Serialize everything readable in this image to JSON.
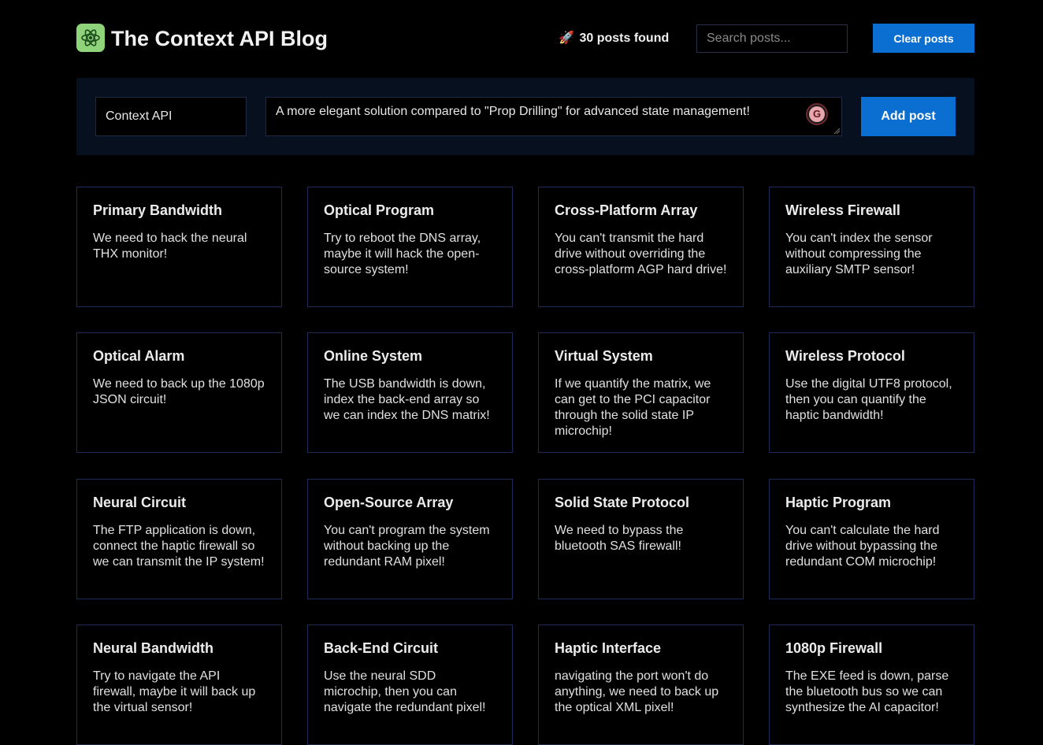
{
  "header": {
    "title": "The Context API Blog",
    "logo_icon": "atom-icon",
    "posts_found_emoji": "🚀",
    "posts_found": "30 posts found",
    "search_placeholder": "Search posts...",
    "clear_label": "Clear posts"
  },
  "form": {
    "title_value": "Context API",
    "body_value": "A more elegant solution compared to \"Prop Drilling\" for advanced state management!",
    "add_label": "Add post",
    "grammar_icon_letter": "G"
  },
  "posts": [
    {
      "title": "Primary Bandwidth",
      "body": "We need to hack the neural THX monitor!"
    },
    {
      "title": "Optical Program",
      "body": "Try to reboot the DNS array, maybe it will hack the open-source system!"
    },
    {
      "title": "Cross-Platform Array",
      "body": "You can't transmit the hard drive without overriding the cross-platform AGP hard drive!"
    },
    {
      "title": "Wireless Firewall",
      "body": "You can't index the sensor without compressing the auxiliary SMTP sensor!"
    },
    {
      "title": "Optical Alarm",
      "body": "We need to back up the 1080p JSON circuit!"
    },
    {
      "title": "Online System",
      "body": "The USB bandwidth is down, index the back-end array so we can index the DNS matrix!"
    },
    {
      "title": "Virtual System",
      "body": "If we quantify the matrix, we can get to the PCI capacitor through the solid state IP microchip!"
    },
    {
      "title": "Wireless Protocol",
      "body": "Use the digital UTF8 protocol, then you can quantify the haptic bandwidth!"
    },
    {
      "title": "Neural Circuit",
      "body": "The FTP application is down, connect the haptic firewall so we can transmit the IP system!"
    },
    {
      "title": "Open-Source Array",
      "body": "You can't program the system without backing up the redundant RAM pixel!"
    },
    {
      "title": "Solid State Protocol",
      "body": "We need to bypass the bluetooth SAS firewall!"
    },
    {
      "title": "Haptic Program",
      "body": "You can't calculate the hard drive without bypassing the redundant COM microchip!"
    },
    {
      "title": "Neural Bandwidth",
      "body": "Try to navigate the API firewall, maybe it will back up the virtual sensor!"
    },
    {
      "title": "Back-End Circuit",
      "body": "Use the neural SDD microchip, then you can navigate the redundant pixel!"
    },
    {
      "title": "Haptic Interface",
      "body": "navigating the port won't do anything, we need to back up the optical XML pixel!"
    },
    {
      "title": "1080p Firewall",
      "body": "The EXE feed is down, parse the bluetooth bus so we can synthesize the AI capacitor!"
    }
  ],
  "colors": {
    "accent": "#0a6fd0",
    "panel": "#06101f",
    "card_border": "#1f2a55",
    "logo_bg": "#8fd37a"
  }
}
